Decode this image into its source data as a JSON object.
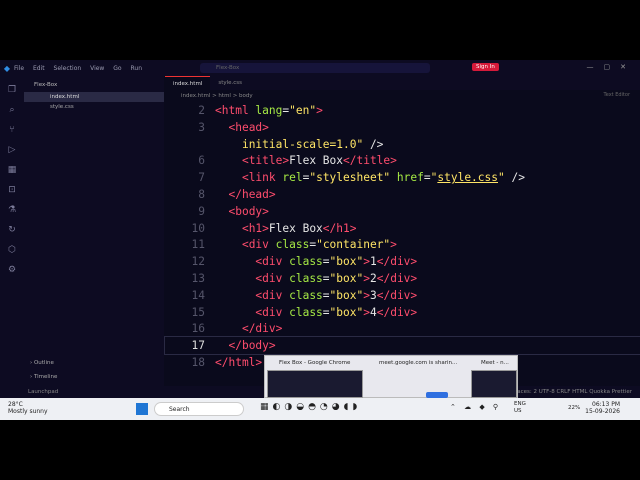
{
  "title": {
    "menu": [
      "File",
      "Edit",
      "Selection",
      "View",
      "Go",
      "Run"
    ],
    "search": "Flex-Box",
    "signin": "Sign In"
  },
  "sidebar": {
    "folder": "Flex-Box",
    "files": [
      "index.html",
      "style.css"
    ],
    "outline": "Outline",
    "timeline": "Timeline"
  },
  "tabs": [
    "index.html",
    "style.css"
  ],
  "breadcrumb": "index.html  >  html  >  body",
  "right_hint": "Text Editor",
  "editor": {
    "lines": [
      {
        "n": "2",
        "parts": [
          [
            "tg",
            "<html "
          ],
          [
            "at",
            "lang"
          ],
          [
            "pl",
            "="
          ],
          [
            "st",
            "\"en\""
          ],
          [
            "tg",
            ">"
          ]
        ]
      },
      {
        "n": "3",
        "parts": [
          [
            "pl",
            "  "
          ],
          [
            "tg",
            "<head>"
          ]
        ]
      },
      {
        "n": "",
        "parts": [
          [
            "pl",
            "    "
          ],
          [
            "st",
            "initial-scale=1.0\""
          ],
          [
            "pl",
            " />"
          ]
        ]
      },
      {
        "n": "6",
        "parts": [
          [
            "pl",
            "    "
          ],
          [
            "tg",
            "<title>"
          ],
          [
            "pl",
            "Flex Box"
          ],
          [
            "tg",
            "</title>"
          ]
        ]
      },
      {
        "n": "7",
        "parts": [
          [
            "pl",
            "    "
          ],
          [
            "tg",
            "<link "
          ],
          [
            "at",
            "rel"
          ],
          [
            "pl",
            "="
          ],
          [
            "st",
            "\"stylesheet\""
          ],
          [
            "pl",
            " "
          ],
          [
            "at",
            "href"
          ],
          [
            "pl",
            "="
          ],
          [
            "st",
            "\""
          ],
          [
            "stu",
            "style.css"
          ],
          [
            "st",
            "\""
          ],
          [
            "pl",
            " />"
          ]
        ]
      },
      {
        "n": "8",
        "parts": [
          [
            "pl",
            "  "
          ],
          [
            "tg",
            "</head>"
          ]
        ]
      },
      {
        "n": "9",
        "parts": [
          [
            "pl",
            "  "
          ],
          [
            "tg",
            "<body>"
          ]
        ]
      },
      {
        "n": "10",
        "parts": [
          [
            "pl",
            "    "
          ],
          [
            "tg",
            "<h1>"
          ],
          [
            "pl",
            "Flex Box"
          ],
          [
            "tg",
            "</h1>"
          ]
        ]
      },
      {
        "n": "11",
        "parts": [
          [
            "pl",
            "    "
          ],
          [
            "tg",
            "<div "
          ],
          [
            "at",
            "class"
          ],
          [
            "pl",
            "="
          ],
          [
            "st",
            "\"container\""
          ],
          [
            "tg",
            ">"
          ]
        ]
      },
      {
        "n": "12",
        "parts": [
          [
            "pl",
            "      "
          ],
          [
            "tg",
            "<div "
          ],
          [
            "at",
            "class"
          ],
          [
            "pl",
            "="
          ],
          [
            "st",
            "\"box\""
          ],
          [
            "tg",
            ">"
          ],
          [
            "pl",
            "1"
          ],
          [
            "tg",
            "</div>"
          ]
        ]
      },
      {
        "n": "13",
        "parts": [
          [
            "pl",
            "      "
          ],
          [
            "tg",
            "<div "
          ],
          [
            "at",
            "class"
          ],
          [
            "pl",
            "="
          ],
          [
            "st",
            "\"box\""
          ],
          [
            "tg",
            ">"
          ],
          [
            "pl",
            "2"
          ],
          [
            "tg",
            "</div>"
          ]
        ]
      },
      {
        "n": "14",
        "parts": [
          [
            "pl",
            "      "
          ],
          [
            "tg",
            "<div "
          ],
          [
            "at",
            "class"
          ],
          [
            "pl",
            "="
          ],
          [
            "st",
            "\"box\""
          ],
          [
            "tg",
            ">"
          ],
          [
            "pl",
            "3"
          ],
          [
            "tg",
            "</div>"
          ]
        ]
      },
      {
        "n": "15",
        "parts": [
          [
            "pl",
            "      "
          ],
          [
            "tg",
            "<div "
          ],
          [
            "at",
            "class"
          ],
          [
            "pl",
            "="
          ],
          [
            "st",
            "\"box\""
          ],
          [
            "tg",
            ">"
          ],
          [
            "pl",
            "4"
          ],
          [
            "tg",
            "</div>"
          ]
        ]
      },
      {
        "n": "16",
        "parts": [
          [
            "pl",
            "    "
          ],
          [
            "tg",
            "</div>"
          ]
        ]
      },
      {
        "n": "17",
        "parts": [
          [
            "pl",
            "  "
          ],
          [
            "tg",
            "</body>"
          ]
        ]
      },
      {
        "n": "18",
        "parts": [
          [
            "tg",
            "</html>"
          ]
        ]
      }
    ],
    "current_line": "17"
  },
  "status": {
    "left": "Launchpad",
    "right": "Ln 17, Col 10   Spaces: 2   UTF-8   CRLF   HTML   Quokka   Prettier"
  },
  "taskbar": {
    "temp": "28°C",
    "weather": "Mostly sunny",
    "search": "Search",
    "lang": "ENG",
    "region": "US",
    "battery": "22%",
    "time": "06:13 PM",
    "date": "15-09-2026"
  },
  "preview": {
    "items": [
      "Flex Box - Google Chrome",
      "meet.google.com is sharin...",
      "Meet - n..."
    ]
  },
  "colors": {
    "accent": "#ff4d6d",
    "attr": "#a5e844",
    "string": "#ffe566",
    "signin": "#d41a3a"
  }
}
